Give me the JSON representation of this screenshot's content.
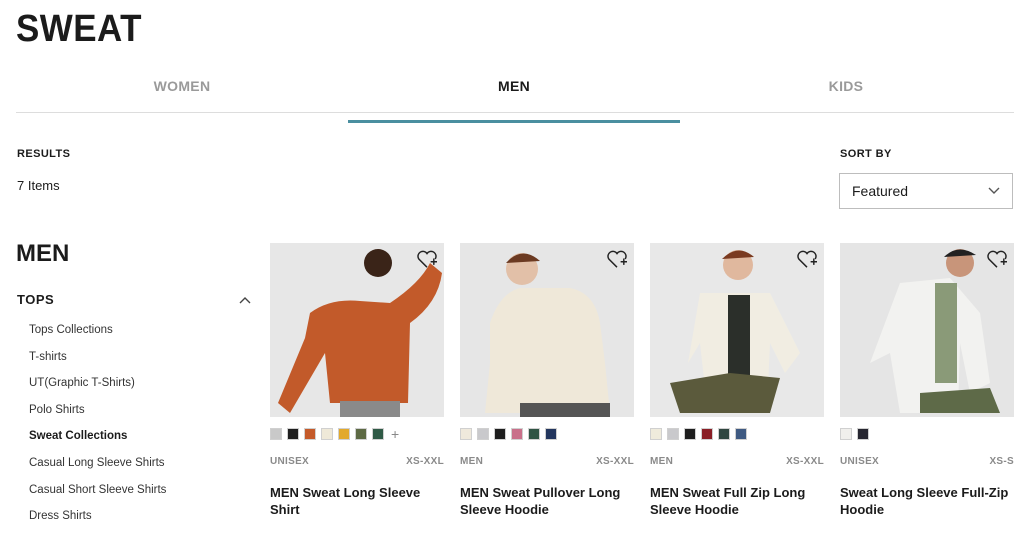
{
  "page": {
    "title": "SWEAT"
  },
  "tabs": [
    {
      "label": "WOMEN"
    },
    {
      "label": "MEN"
    },
    {
      "label": "KIDS"
    }
  ],
  "results": {
    "label": "RESULTS",
    "count": "7 Items"
  },
  "sort": {
    "label": "SORT BY",
    "value": "Featured"
  },
  "sidebar": {
    "heading": "MEN",
    "category": "TOPS",
    "items": [
      {
        "label": "Tops Collections"
      },
      {
        "label": "T-shirts"
      },
      {
        "label": "UT(Graphic T-Shirts)"
      },
      {
        "label": "Polo Shirts"
      },
      {
        "label": "Sweat Collections"
      },
      {
        "label": "Casual Long Sleeve Shirts"
      },
      {
        "label": "Casual Short Sleeve Shirts"
      },
      {
        "label": "Dress Shirts"
      }
    ]
  },
  "products": [
    {
      "gender": "UNISEX",
      "sizes": "XS-XXL",
      "name": "MEN Sweat Long Sleeve Shirt",
      "colors": [
        "#c9c9c9",
        "#1e1e1e",
        "#c45a2a",
        "#efe9d8",
        "#e2a92c",
        "#5d6a44",
        "#2f5a46"
      ],
      "more": "+"
    },
    {
      "gender": "MEN",
      "sizes": "XS-XXL",
      "name": "MEN Sweat Pullover Long Sleeve Hoodie",
      "colors": [
        "#efe9dc",
        "#c9c9cc",
        "#1e1e1e",
        "#c9708a",
        "#2f5444",
        "#23365e"
      ]
    },
    {
      "gender": "MEN",
      "sizes": "XS-XXL",
      "name": "MEN Sweat Full Zip Long Sleeve Hoodie",
      "colors": [
        "#efebdc",
        "#c9c9cc",
        "#1e1e1e",
        "#8a1f26",
        "#2f4640",
        "#3f5a82"
      ]
    },
    {
      "gender": "UNISEX",
      "sizes": "XS-S",
      "name": "Sweat Long Sleeve Full-Zip Hoodie",
      "colors": [
        "#f0efec",
        "#262630"
      ]
    }
  ],
  "colors": {
    "accent": "#4a8fa0",
    "text": "#1b1b1b",
    "muted": "#9a9a9a"
  }
}
